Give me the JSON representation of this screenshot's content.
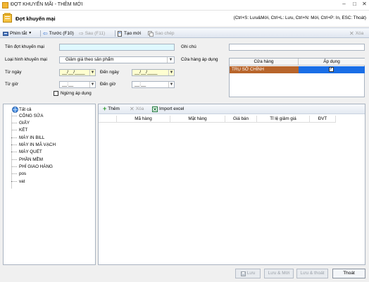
{
  "window": {
    "title": "ĐỢT KHUYẾN MÃI - THÊM MỚI"
  },
  "header": {
    "heading": "Đợt khuyến mại",
    "shortcuts": "(Ctrl+S: Lưu&Mới, Ctrl+L: Lưu, Ctrl+N: Mới, Ctrl+P: In, ESC: Thoát)"
  },
  "toolbar": {
    "shortcut_key": "Phím tắt",
    "prev": "Trước (F10)",
    "next": "Sau (F11)",
    "new": "Tạo mới",
    "copy": "Sao chép",
    "delete": "Xóa"
  },
  "form": {
    "name_label": "Tên đợt khuyến mại",
    "name_value": "",
    "note_label": "Ghi chú",
    "note_value": "",
    "type_label": "Loại hình khuyến mại",
    "type_value": "Giảm giá theo sản phẩm",
    "stores_label": "Cửa hàng áp dụng",
    "from_date_label": "Từ ngày",
    "from_date_value": "__/__/____",
    "to_date_label": "Đến ngày",
    "to_date_value": "__/__/____",
    "from_time_label": "Từ giờ",
    "from_time_value": "__:__",
    "to_time_label": "Đến giờ",
    "to_time_value": "__:__",
    "stop_label": "Ngừng áp dụng"
  },
  "store_grid": {
    "columns": [
      "Cửa hàng",
      "Áp dụng"
    ],
    "rows": [
      {
        "name": "TRỤ SỞ CHÍNH",
        "applied": true
      }
    ]
  },
  "tree": {
    "items": [
      "Tất cả",
      "CÔNG SỬA",
      "GIẤY",
      "KÉT",
      "MÁY IN BILL",
      "MÁY IN MÃ VẠCH",
      "MÁY QUÉT",
      "PHẦN MỀM",
      "PHÍ GIAO HÀNG",
      "pos",
      "vat"
    ]
  },
  "products": {
    "add": "Thêm",
    "delete": "Xóa",
    "import": "Import excel",
    "columns": [
      "Mã hàng",
      "Mặt hàng",
      "Giá bán",
      "Tỉ lệ giảm giá",
      "ĐVT"
    ]
  },
  "footer": {
    "save": "Lưu",
    "save_new": "Lưu & Mới",
    "save_exit": "Lưu & thoát",
    "exit": "Thoát"
  },
  "colors": {
    "store_row_bg": "#b8652b",
    "applied_cell_bg": "#1a6ee6",
    "date_bg": "#ffffd0",
    "name_bg": "#dff8ff"
  }
}
